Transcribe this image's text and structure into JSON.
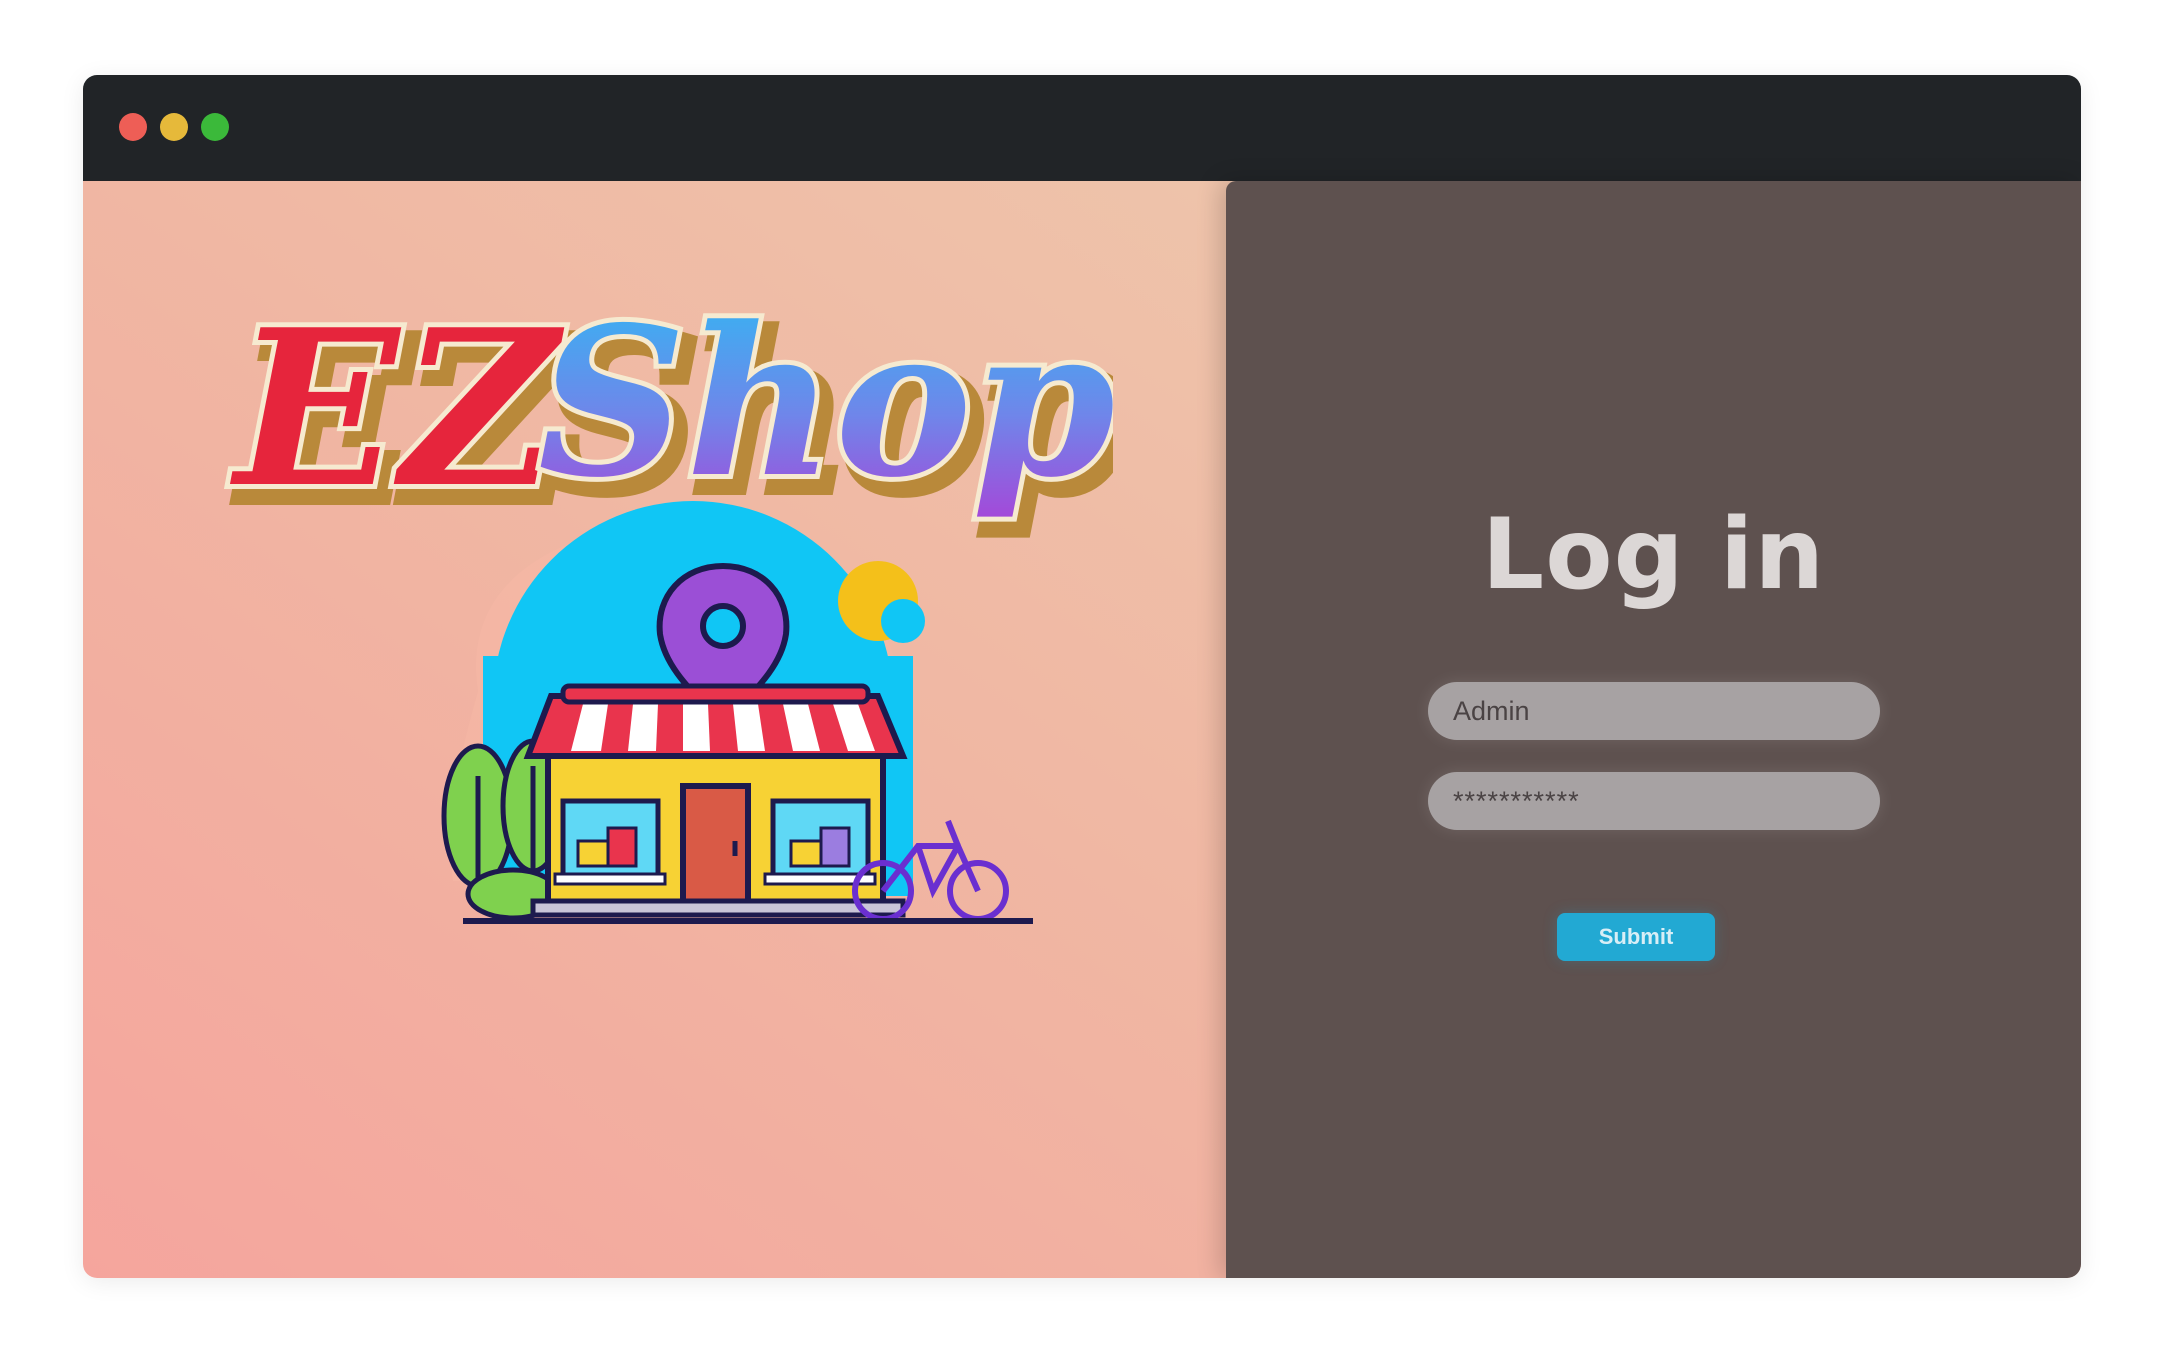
{
  "window": {
    "controls": [
      "close",
      "minimize",
      "zoom"
    ]
  },
  "hero": {
    "logo_text": "EZShop",
    "illustration": "storefront-icon"
  },
  "login": {
    "title": "Log in",
    "username_value": "Admin",
    "password_value": "***********",
    "submit_label": "Submit"
  },
  "colors": {
    "titlebar": "#212427",
    "panel": "#5e514f",
    "submit": "#22a9d3",
    "field": "#a7a2a3"
  }
}
